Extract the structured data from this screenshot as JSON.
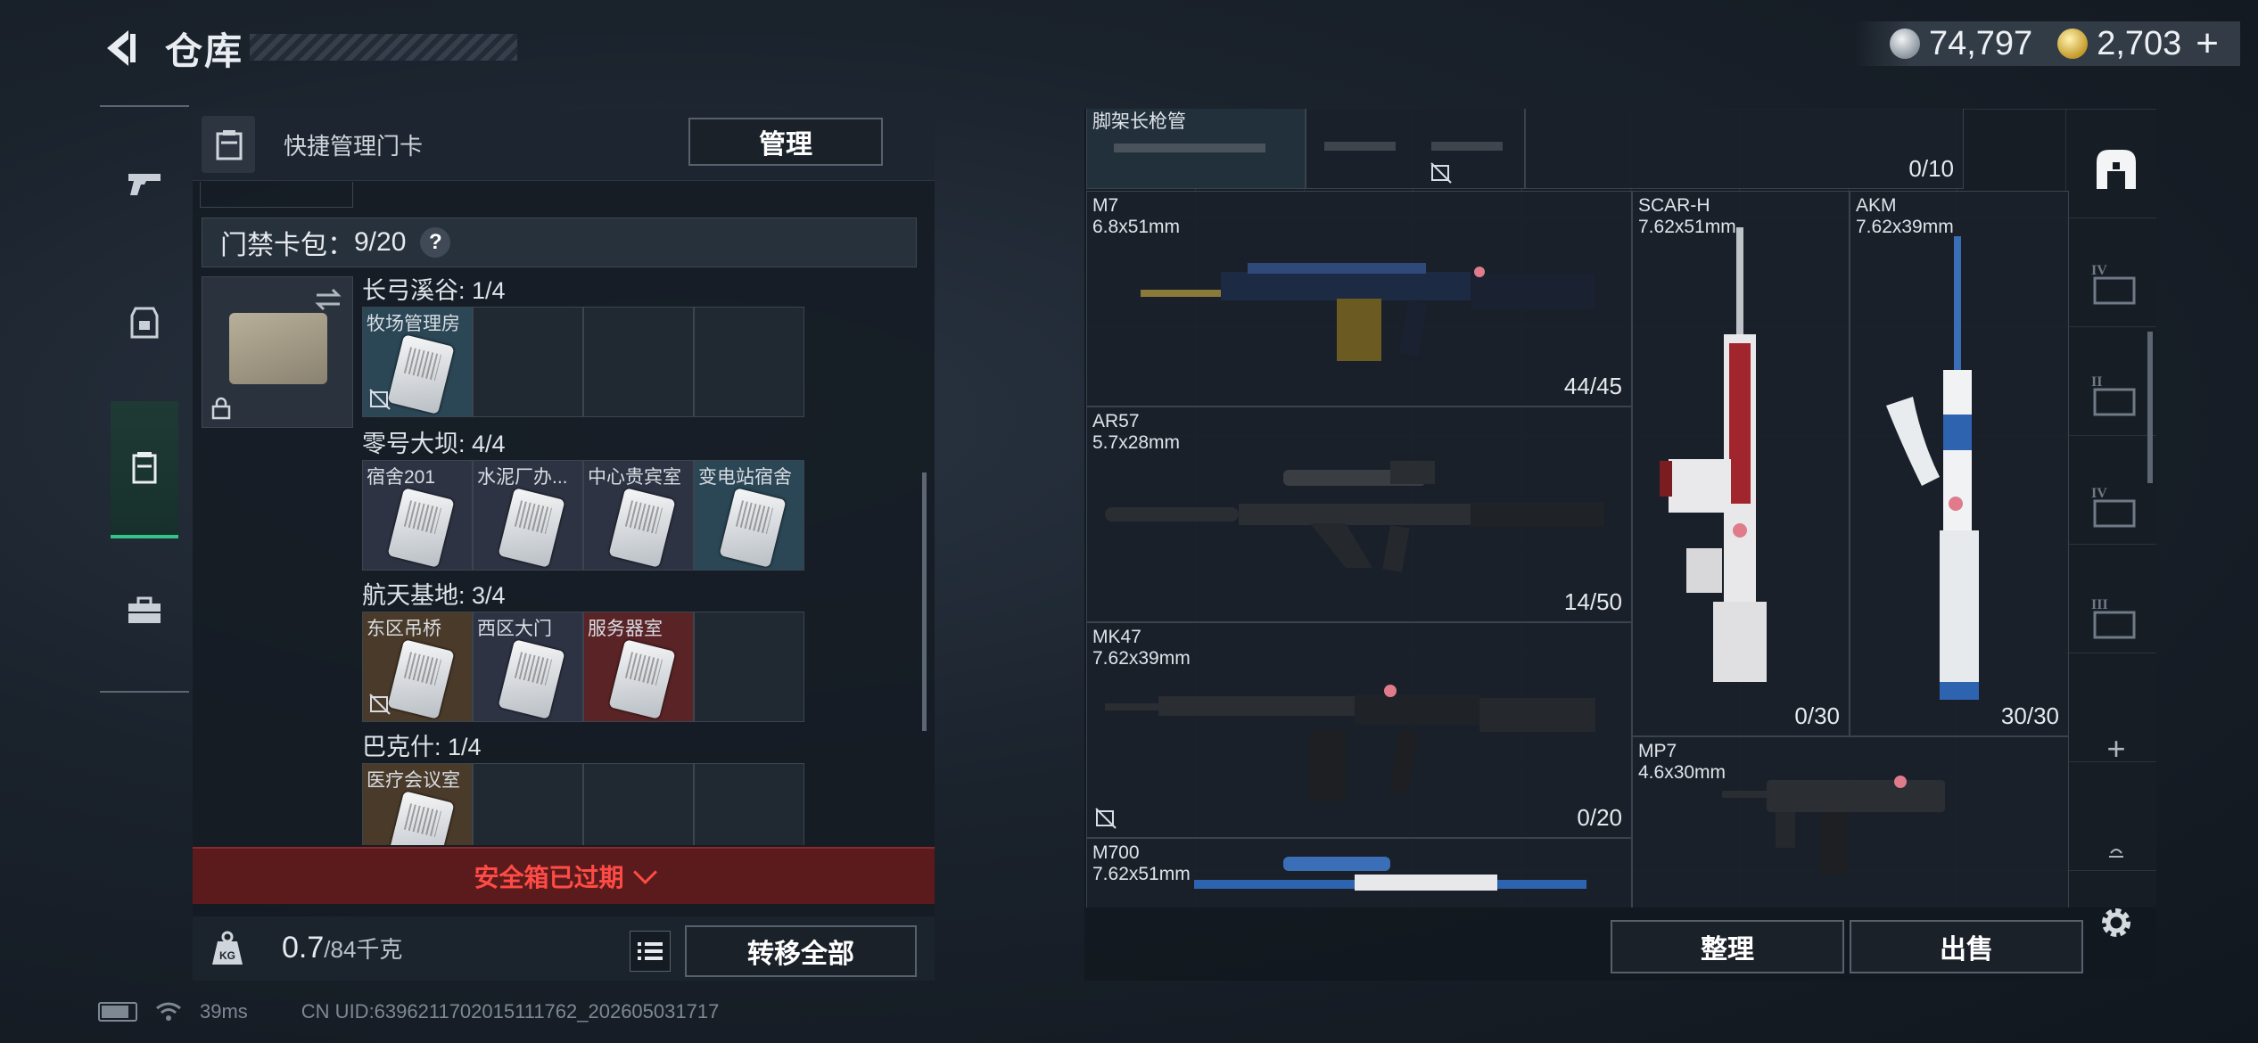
{
  "header": {
    "title": "仓库",
    "currency": [
      {
        "icon": "silver-coin-icon",
        "value": "74,797"
      },
      {
        "icon": "gold-coin-icon",
        "value": "2,703"
      }
    ],
    "add_label": "+"
  },
  "left_nav": {
    "items": [
      {
        "name": "pistol-icon"
      },
      {
        "name": "backpack-icon"
      },
      {
        "name": "keycard-holder-icon",
        "active": true
      },
      {
        "name": "briefcase-icon"
      }
    ]
  },
  "left_panel": {
    "quick_label": "快捷管理门卡",
    "manage_label": "管理",
    "keyring_label": "门禁卡包：",
    "keyring_count": "9/20",
    "help_label": "?",
    "groups": [
      {
        "label": "长弓溪谷: 1/4",
        "slots": [
          {
            "label": "牧场管理房",
            "has_card": true,
            "locked": true,
            "tint": "#2b4655"
          },
          {},
          {},
          {}
        ]
      },
      {
        "label": "零号大坝: 4/4",
        "slots": [
          {
            "label": "宿舍201",
            "has_card": true,
            "tint": "#2e3344"
          },
          {
            "label": "水泥厂办...",
            "has_card": true,
            "tint": "#2e3344"
          },
          {
            "label": "中心贵宾室",
            "has_card": true,
            "tint": "#2e3344"
          },
          {
            "label": "变电站宿舍",
            "has_card": true,
            "tint": "#2b4655"
          }
        ]
      },
      {
        "label": "航天基地: 3/4",
        "slots": [
          {
            "label": "东区吊桥",
            "has_card": true,
            "locked": true,
            "tint": "#4a3a2a"
          },
          {
            "label": "西区大门",
            "has_card": true,
            "tint": "#2e3344"
          },
          {
            "label": "服务器室",
            "has_card": true,
            "tint": "#5a2426"
          },
          {}
        ]
      },
      {
        "label": "巴克什: 1/4",
        "slots": [
          {
            "label": "医疗会议室",
            "has_card": true,
            "tint": "#4a3a2a"
          },
          {},
          {},
          {}
        ]
      }
    ],
    "safe_box_label": "安全箱已过期",
    "weight_value": "0.7",
    "weight_max": "/84千克",
    "transfer_label": "转移全部"
  },
  "status_bar": {
    "ping": "39ms",
    "uid": "CN UID:6396211702015111762_202605031717"
  },
  "right_panel": {
    "top_item": {
      "label": "脚架长枪管",
      "count": "0/10"
    },
    "weapons": [
      {
        "name": "M7",
        "caliber": "6.8x51mm",
        "count": "44/45"
      },
      {
        "name": "SCAR-H",
        "caliber": "7.62x51mm",
        "count": "0/30"
      },
      {
        "name": "AKM",
        "caliber": "7.62x39mm",
        "count": "30/30"
      },
      {
        "name": "AR57",
        "caliber": "5.7x28mm",
        "count": "14/50"
      },
      {
        "name": "MK47",
        "caliber": "7.62x39mm",
        "count": "0/20"
      },
      {
        "name": "MP7",
        "caliber": "4.6x30mm",
        "count": ""
      },
      {
        "name": "M700",
        "caliber": "7.62x51mm",
        "count": ""
      }
    ],
    "sort_label": "整理",
    "sell_label": "出售"
  },
  "right_nav": {
    "items": [
      {
        "name": "safe-box-icon",
        "active": true
      },
      {
        "name": "case-iv-icon",
        "label": "IV"
      },
      {
        "name": "case-ii-icon",
        "label": "II"
      },
      {
        "name": "case-iv-b-icon",
        "label": "IV"
      },
      {
        "name": "case-iii-icon",
        "label": "III"
      },
      {
        "name": "add-icon",
        "label": "+"
      },
      {
        "name": "flag-icon"
      },
      {
        "name": "gear-icon"
      }
    ]
  },
  "colors": {
    "accent_green": "#34c38a",
    "warning_red": "#ff4b45"
  }
}
